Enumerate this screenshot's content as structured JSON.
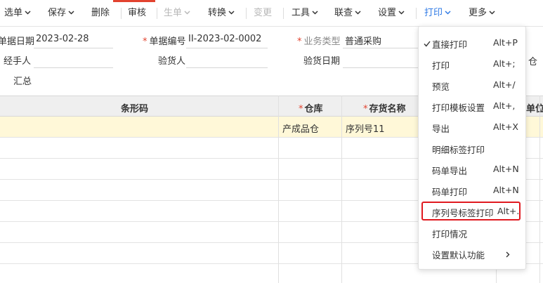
{
  "toolbar": {
    "items": [
      {
        "label": "选单",
        "dropdown": true
      },
      {
        "label": "保存",
        "dropdown": true
      },
      {
        "label": "删除",
        "dropdown": false
      },
      {
        "label": "审核",
        "dropdown": false
      },
      {
        "label": "生单",
        "dropdown": true,
        "disabled": true
      },
      {
        "label": "转换",
        "dropdown": true
      },
      {
        "label": "变更",
        "dropdown": false,
        "disabled": true
      },
      {
        "label": "工具",
        "dropdown": true
      },
      {
        "label": "联查",
        "dropdown": true
      },
      {
        "label": "设置",
        "dropdown": true
      },
      {
        "label": "打印",
        "dropdown": true,
        "active": true
      },
      {
        "label": "更多",
        "dropdown": true
      }
    ]
  },
  "form": {
    "doc_date_label": "单据日期",
    "doc_date_value": "2023-02-28",
    "doc_no_label": "单据编号",
    "doc_no_value": "II-2023-02-0002",
    "biz_type_label": "业务类型",
    "biz_type_value": "普通采购",
    "handler_label": "经手人",
    "inspector_label": "验货人",
    "inspect_date_label": "验货日期",
    "summary_label": "汇总",
    "cut_right_1": "仓",
    "cut_right_2": "单位"
  },
  "grid": {
    "headers": {
      "barcode": "条形码",
      "warehouse": "仓库",
      "inventory_name": "存货名称"
    },
    "rows": [
      {
        "warehouse": "产成品仓",
        "inventory_name": "序列号11"
      }
    ]
  },
  "print_menu": {
    "items": [
      {
        "label": "直接打印",
        "shortcut": "Alt+P",
        "checked": true
      },
      {
        "label": "打印",
        "shortcut": "Alt+;"
      },
      {
        "label": "预览",
        "shortcut": "Alt+/"
      },
      {
        "label": "打印模板设置",
        "shortcut": "Alt+,"
      },
      {
        "label": "导出",
        "shortcut": "Alt+X"
      },
      {
        "label": "明细标签打印",
        "shortcut": ""
      },
      {
        "label": "码单导出",
        "shortcut": "Alt+N"
      },
      {
        "label": "码单打印",
        "shortcut": "Alt+N"
      },
      {
        "label": "序列号标签打印",
        "shortcut": "Alt+.",
        "highlighted": true
      },
      {
        "label": "打印情况",
        "shortcut": ""
      },
      {
        "label": "设置默认功能",
        "shortcut": "",
        "submenu": true
      }
    ]
  },
  "colors": {
    "accent": "#2f7ae5",
    "required": "#e2432f",
    "highlight_box": "#e0191f",
    "row_highlight": "#fff8d8"
  }
}
